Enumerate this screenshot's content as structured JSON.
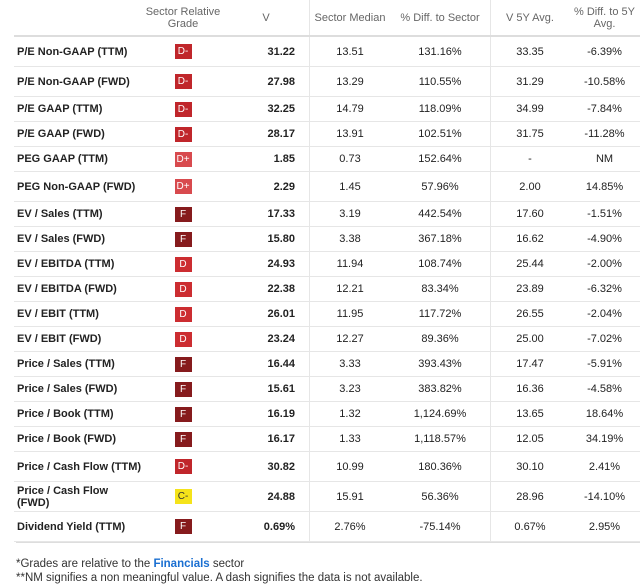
{
  "headers": [
    "",
    "Sector Relative Grade",
    "V",
    "Sector Median",
    "% Diff. to Sector",
    "V 5Y Avg.",
    "% Diff. to 5Y Avg."
  ],
  "grade_colors": {
    "D-": "#c0262b",
    "D+": "#d84a4e",
    "D": "#cc2d31",
    "F": "#861b1d",
    "C-": "#f5e31a"
  },
  "rows": [
    {
      "label": "P/E Non-GAAP (TTM)",
      "grade": "D-",
      "v": "31.22",
      "median": "13.51",
      "diff": "131.16%",
      "avg5": "33.35",
      "diff5": "-6.39%"
    },
    {
      "label": "P/E Non-GAAP (FWD)",
      "grade": "D-",
      "v": "27.98",
      "median": "13.29",
      "diff": "110.55%",
      "avg5": "31.29",
      "diff5": "-10.58%"
    },
    {
      "label": "P/E GAAP (TTM)",
      "grade": "D-",
      "v": "32.25",
      "median": "14.79",
      "diff": "118.09%",
      "avg5": "34.99",
      "diff5": "-7.84%"
    },
    {
      "label": "P/E GAAP (FWD)",
      "grade": "D-",
      "v": "28.17",
      "median": "13.91",
      "diff": "102.51%",
      "avg5": "31.75",
      "diff5": "-11.28%"
    },
    {
      "label": "PEG GAAP (TTM)",
      "grade": "D+",
      "v": "1.85",
      "median": "0.73",
      "diff": "152.64%",
      "avg5": "-",
      "diff5": "NM"
    },
    {
      "label": "PEG Non-GAAP (FWD)",
      "grade": "D+",
      "v": "2.29",
      "median": "1.45",
      "diff": "57.96%",
      "avg5": "2.00",
      "diff5": "14.85%"
    },
    {
      "label": "EV / Sales (TTM)",
      "grade": "F",
      "v": "17.33",
      "median": "3.19",
      "diff": "442.54%",
      "avg5": "17.60",
      "diff5": "-1.51%"
    },
    {
      "label": "EV / Sales (FWD)",
      "grade": "F",
      "v": "15.80",
      "median": "3.38",
      "diff": "367.18%",
      "avg5": "16.62",
      "diff5": "-4.90%"
    },
    {
      "label": "EV / EBITDA (TTM)",
      "grade": "D",
      "v": "24.93",
      "median": "11.94",
      "diff": "108.74%",
      "avg5": "25.44",
      "diff5": "-2.00%"
    },
    {
      "label": "EV / EBITDA (FWD)",
      "grade": "D",
      "v": "22.38",
      "median": "12.21",
      "diff": "83.34%",
      "avg5": "23.89",
      "diff5": "-6.32%"
    },
    {
      "label": "EV / EBIT (TTM)",
      "grade": "D",
      "v": "26.01",
      "median": "11.95",
      "diff": "117.72%",
      "avg5": "26.55",
      "diff5": "-2.04%"
    },
    {
      "label": "EV / EBIT (FWD)",
      "grade": "D",
      "v": "23.24",
      "median": "12.27",
      "diff": "89.36%",
      "avg5": "25.00",
      "diff5": "-7.02%"
    },
    {
      "label": "Price / Sales (TTM)",
      "grade": "F",
      "v": "16.44",
      "median": "3.33",
      "diff": "393.43%",
      "avg5": "17.47",
      "diff5": "-5.91%"
    },
    {
      "label": "Price / Sales (FWD)",
      "grade": "F",
      "v": "15.61",
      "median": "3.23",
      "diff": "383.82%",
      "avg5": "16.36",
      "diff5": "-4.58%"
    },
    {
      "label": "Price / Book (TTM)",
      "grade": "F",
      "v": "16.19",
      "median": "1.32",
      "diff": "1,124.69%",
      "avg5": "13.65",
      "diff5": "18.64%"
    },
    {
      "label": "Price / Book (FWD)",
      "grade": "F",
      "v": "16.17",
      "median": "1.33",
      "diff": "1,118.57%",
      "avg5": "12.05",
      "diff5": "34.19%"
    },
    {
      "label": "Price / Cash Flow (TTM)",
      "grade": "D-",
      "v": "30.82",
      "median": "10.99",
      "diff": "180.36%",
      "avg5": "30.10",
      "diff5": "2.41%"
    },
    {
      "label": "Price / Cash Flow (FWD)",
      "grade": "C-",
      "v": "24.88",
      "median": "15.91",
      "diff": "56.36%",
      "avg5": "28.96",
      "diff5": "-14.10%"
    },
    {
      "label": "Dividend Yield (TTM)",
      "grade": "F",
      "v": "0.69%",
      "median": "2.76%",
      "diff": "-75.14%",
      "avg5": "0.67%",
      "diff5": "2.95%"
    }
  ],
  "footnote1_pre": "*Grades are relative to the ",
  "footnote1_link": "Financials",
  "footnote1_post": " sector",
  "footnote2": "**NM signifies a non meaningful value. A dash signifies the data is not available."
}
